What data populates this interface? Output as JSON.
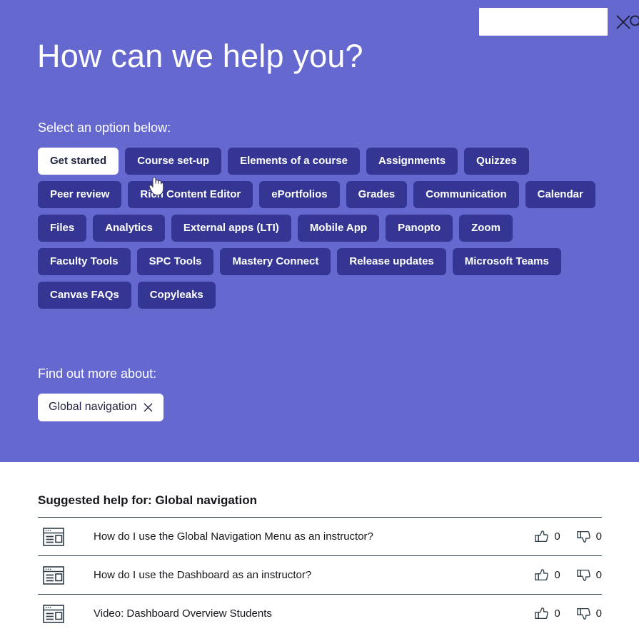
{
  "header": {
    "search_value": "",
    "search_placeholder": "",
    "search_icon": "search-icon",
    "close_icon": "close-icon"
  },
  "hero": {
    "title": "How can we help you?",
    "select_label": "Select an option below:",
    "find_label": "Find out more about:",
    "bg_color": "#6569cf",
    "chip_color": "#353593",
    "chips": [
      {
        "label": "Get started",
        "active": true
      },
      {
        "label": "Course set-up",
        "active": false
      },
      {
        "label": "Elements of a course",
        "active": false
      },
      {
        "label": "Assignments",
        "active": false
      },
      {
        "label": "Quizzes",
        "active": false
      },
      {
        "label": "Peer review",
        "active": false
      },
      {
        "label": "Rich Content Editor",
        "active": false
      },
      {
        "label": "ePortfolios",
        "active": false
      },
      {
        "label": "Grades",
        "active": false
      },
      {
        "label": "Communication",
        "active": false
      },
      {
        "label": "Calendar",
        "active": false
      },
      {
        "label": "Files",
        "active": false
      },
      {
        "label": "Analytics",
        "active": false
      },
      {
        "label": "External apps (LTI)",
        "active": false
      },
      {
        "label": "Mobile App",
        "active": false
      },
      {
        "label": "Panopto",
        "active": false
      },
      {
        "label": "Zoom",
        "active": false
      },
      {
        "label": "Faculty Tools",
        "active": false
      },
      {
        "label": "SPC Tools",
        "active": false
      },
      {
        "label": "Mastery Connect",
        "active": false
      },
      {
        "label": "Release updates",
        "active": false
      },
      {
        "label": "Microsoft Teams",
        "active": false
      },
      {
        "label": "Canvas FAQs",
        "active": false
      },
      {
        "label": "Copyleaks",
        "active": false
      }
    ],
    "tags": [
      {
        "label": "Global navigation",
        "remove_icon": "close-icon"
      }
    ]
  },
  "suggestions": {
    "title": "Suggested help for: Global navigation",
    "rows": [
      {
        "icon": "article-page-icon",
        "title": "How do I use the Global Navigation Menu as an instructor?",
        "likes": "0",
        "dislikes": "0"
      },
      {
        "icon": "article-page-icon",
        "title": "How do I use the Dashboard as an instructor?",
        "likes": "0",
        "dislikes": "0"
      },
      {
        "icon": "article-page-icon",
        "title": "Video: Dashboard Overview Students",
        "likes": "0",
        "dislikes": "0"
      }
    ]
  }
}
